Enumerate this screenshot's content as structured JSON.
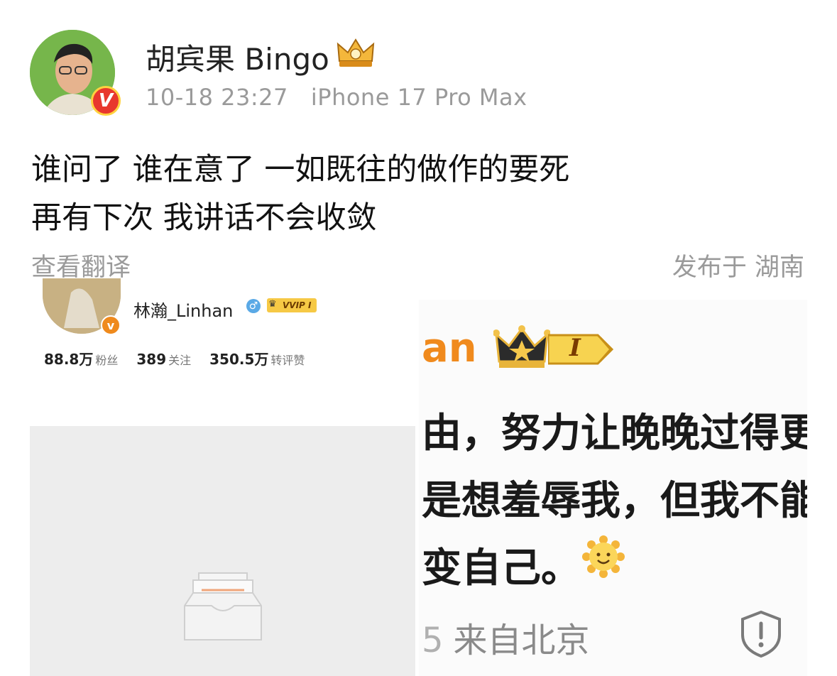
{
  "post": {
    "author_name": "胡宾果 Bingo",
    "time": "10-18 23:27",
    "device": "iPhone 17 Pro Max",
    "verified_badge": "V",
    "lines": [
      "谁问了 谁在意了 一如既往的做作的要死",
      "再有下次 我讲话不会收敛"
    ],
    "translate_label": "查看翻译",
    "location_label": "发布于 湖南"
  },
  "left_screenshot": {
    "name": "林瀚_Linhan",
    "gender_icon": "♂",
    "vvip_label": "VVIP I",
    "badge": "v",
    "stats": [
      {
        "value": "88.8万",
        "label": "粉丝"
      },
      {
        "value": "389",
        "label": "关注"
      },
      {
        "value": "350.5万",
        "label": "转评赞"
      }
    ]
  },
  "right_screenshot": {
    "name_fragment": "an",
    "rank_label": "I",
    "lines": [
      "由，努力让晚晚过得更",
      "是想羞辱我，但我不能",
      "变自己。"
    ],
    "footer": "来自北京",
    "footer_prefix": "5"
  },
  "colors": {
    "accent_orange": "#f08a1d",
    "verified_red": "#e8372d",
    "gray_text": "#9a9a9a",
    "empty_bg": "#ededed"
  }
}
